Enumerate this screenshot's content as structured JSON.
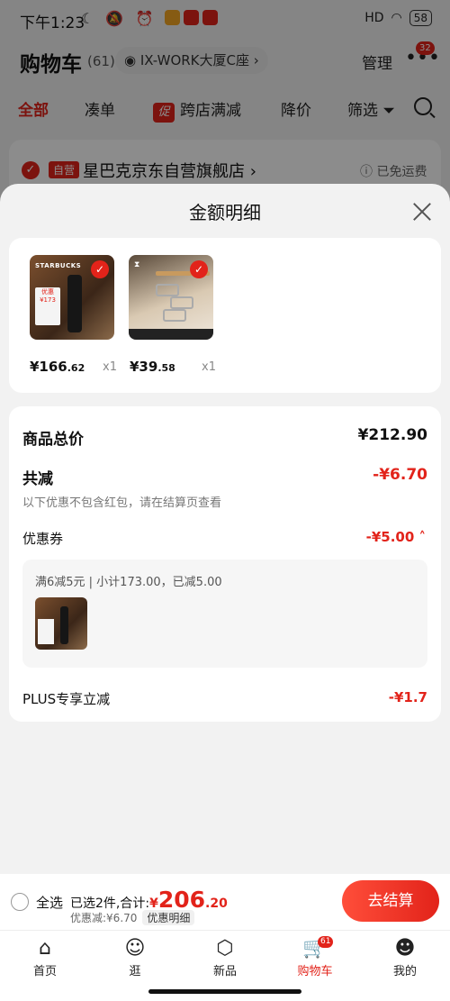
{
  "status_bar": {
    "time": "下午1:23",
    "signal": "HD",
    "battery": "58"
  },
  "cart_header": {
    "title": "购物车",
    "count": "(61)",
    "address": "IX-WORK大厦C座 ›",
    "manage": "管理",
    "more_badge": "32"
  },
  "tabs": [
    {
      "label": "全部"
    },
    {
      "label": "凑单"
    },
    {
      "label": "跨店满减",
      "tag": "促"
    },
    {
      "label": "降价"
    },
    {
      "label": "筛选"
    }
  ],
  "store": {
    "self_tag": "自营",
    "name": "星巴克京东自营旗舰店 ›",
    "free_shipping": "ⓘ 已免运费"
  },
  "sheet": {
    "title": "金额明细",
    "products": [
      {
        "price_int": "¥166",
        "price_dec": ".62",
        "qty": "x1",
        "thumb_brand": "STARBUCKS"
      },
      {
        "price_int": "¥39",
        "price_dec": ".58",
        "qty": "x1",
        "thumb_brand": ""
      }
    ],
    "detail": {
      "total_label": "商品总价",
      "total_value": "¥212.90",
      "reduce_label": "共减",
      "reduce_value": "-¥6.70",
      "hint": "以下优惠不包含红包，请在结算页查看",
      "coupon_label": "优惠券",
      "coupon_value": "-¥5.00 ˄",
      "coupon_desc": "满6减5元 | 小计173.00，已减5.00",
      "plus_label": "PLUS专享立减",
      "plus_value": "-¥1.7"
    }
  },
  "checkout": {
    "select_all": "全选",
    "selected_prefix": "已选2件,合计:",
    "total_currency": "¥",
    "total_int": "206",
    "total_dec": ".20",
    "discount": "优惠减:¥6.70",
    "detail_pill": "优惠明细",
    "button": "去结算"
  },
  "bottom_nav": [
    {
      "label": "首页",
      "icon": "home-icon"
    },
    {
      "label": "逛",
      "icon": "explore-icon"
    },
    {
      "label": "新品",
      "icon": "cube-icon"
    },
    {
      "label": "购物车",
      "icon": "cart-icon",
      "badge": "61"
    },
    {
      "label": "我的",
      "icon": "user-icon"
    }
  ],
  "colors": {
    "accent": "#e2231a",
    "background": "#f2f2f2"
  }
}
